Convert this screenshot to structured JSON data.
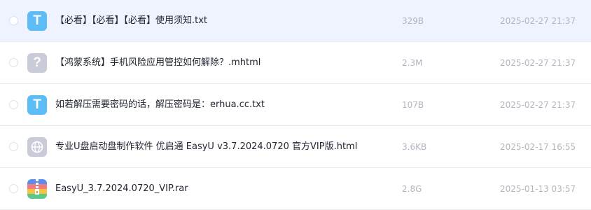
{
  "files": [
    {
      "name": "【必看】【必看】【必看】使用须知.txt",
      "size": "329B",
      "date": "2025-02-27 21:37",
      "icon": "txt-file-icon",
      "icon_glyph": "T"
    },
    {
      "name": "【鸿蒙系统】手机风险应用管控如何解除？.mhtml",
      "size": "2.3M",
      "date": "2025-02-27 21:37",
      "icon": "unknown-file-icon",
      "icon_glyph": "?"
    },
    {
      "name": "如若解压需要密码的话，解压密码是：erhua.cc.txt",
      "size": "107B",
      "date": "2025-02-27 21:37",
      "icon": "txt-file-icon",
      "icon_glyph": "T"
    },
    {
      "name": "专业U盘启动盘制作软件 优启通 EasyU v3.7.2024.0720 官方VIP版.html",
      "size": "3.6KB",
      "date": "2025-02-17 16:55",
      "icon": "web-file-icon",
      "icon_glyph": ""
    },
    {
      "name": "EasyU_3.7.2024.0720_VIP.rar",
      "size": "2.8G",
      "date": "2025-01-13 03:57",
      "icon": "archive-file-icon",
      "icon_glyph": ""
    }
  ],
  "colors": {
    "highlight_row": "#eef3ff",
    "txt_icon": "#5bbcf6",
    "generic_icon": "#c9ccd8",
    "meta_text": "#b1b5bf"
  }
}
